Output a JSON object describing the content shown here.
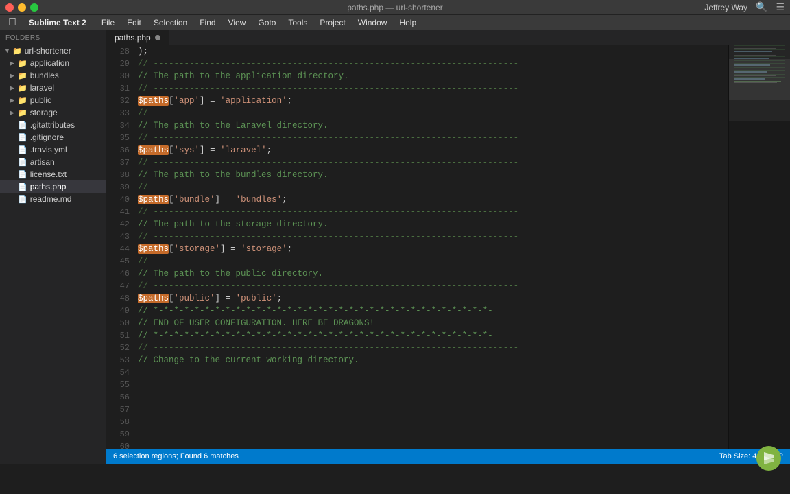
{
  "titlebar": {
    "app_name": "Sublime Text 2",
    "file_title": "paths.php — url-shortener",
    "user": "Jeffrey Way"
  },
  "menubar": {
    "items": [
      "File",
      "Edit",
      "Selection",
      "Find",
      "View",
      "Goto",
      "Tools",
      "Project",
      "Window",
      "Help"
    ]
  },
  "sidebar": {
    "header": "FOLDERS",
    "root": "url-shortener",
    "items": [
      {
        "label": "application",
        "type": "folder",
        "indent": 1,
        "expanded": false
      },
      {
        "label": "bundles",
        "type": "folder",
        "indent": 1,
        "expanded": false
      },
      {
        "label": "laravel",
        "type": "folder",
        "indent": 1,
        "expanded": false
      },
      {
        "label": "public",
        "type": "folder",
        "indent": 1,
        "expanded": false
      },
      {
        "label": "storage",
        "type": "folder",
        "indent": 1,
        "expanded": false
      },
      {
        "label": ".gitattributes",
        "type": "file",
        "indent": 1
      },
      {
        "label": ".gitignore",
        "type": "file",
        "indent": 1
      },
      {
        "label": ".travis.yml",
        "type": "file",
        "indent": 1
      },
      {
        "label": "artisan",
        "type": "file",
        "indent": 1
      },
      {
        "label": "license.txt",
        "type": "file",
        "indent": 1
      },
      {
        "label": "paths.php",
        "type": "file",
        "indent": 1,
        "active": true
      },
      {
        "label": "readme.md",
        "type": "file",
        "indent": 1
      }
    ]
  },
  "tab": {
    "filename": "paths.php",
    "modified": true
  },
  "code": {
    "lines": [
      {
        "num": 28,
        "content": ");"
      },
      {
        "num": 29,
        "content": ""
      },
      {
        "num": 30,
        "content": "// -----------------------------------------------------------------------"
      },
      {
        "num": 31,
        "content": "// The path to the application directory."
      },
      {
        "num": 32,
        "content": "// -----------------------------------------------------------------------"
      },
      {
        "num": 33,
        "content": "$paths['app'] = 'application';",
        "highlight_var": true
      },
      {
        "num": 34,
        "content": ""
      },
      {
        "num": 35,
        "content": "// -----------------------------------------------------------------------"
      },
      {
        "num": 36,
        "content": "// The path to the Laravel directory."
      },
      {
        "num": 37,
        "content": "// -----------------------------------------------------------------------"
      },
      {
        "num": 38,
        "content": "$paths['sys'] = 'laravel';",
        "highlight_var": true
      },
      {
        "num": 39,
        "content": ""
      },
      {
        "num": 40,
        "content": "// -----------------------------------------------------------------------"
      },
      {
        "num": 41,
        "content": "// The path to the bundles directory."
      },
      {
        "num": 42,
        "content": "// -----------------------------------------------------------------------"
      },
      {
        "num": 43,
        "content": "$paths['bundle'] = 'bundles';",
        "highlight_var": true
      },
      {
        "num": 44,
        "content": ""
      },
      {
        "num": 45,
        "content": "// -----------------------------------------------------------------------"
      },
      {
        "num": 46,
        "content": "// The path to the storage directory."
      },
      {
        "num": 47,
        "content": "// -----------------------------------------------------------------------"
      },
      {
        "num": 48,
        "content": "$paths['storage'] = 'storage';",
        "highlight_var": true
      },
      {
        "num": 49,
        "content": ""
      },
      {
        "num": 50,
        "content": "// -----------------------------------------------------------------------"
      },
      {
        "num": 51,
        "content": "// The path to the public directory."
      },
      {
        "num": 52,
        "content": "// -----------------------------------------------------------------------"
      },
      {
        "num": 53,
        "content": "$paths['public'] = 'public';",
        "highlight_var": true
      },
      {
        "num": 54,
        "content": ""
      },
      {
        "num": 55,
        "content": "// *-*-*-*-*-*-*-*-*-*-*-*-*-*-*-*-*-*-*-*-*-*-*-*-*-*-*-*-*-*-*-*-*-"
      },
      {
        "num": 56,
        "content": "// END OF USER CONFIGURATION. HERE BE DRAGONS!"
      },
      {
        "num": 57,
        "content": "// *-*-*-*-*-*-*-*-*-*-*-*-*-*-*-*-*-*-*-*-*-*-*-*-*-*-*-*-*-*-*-*-*-"
      },
      {
        "num": 58,
        "content": ""
      },
      {
        "num": 59,
        "content": "// -----------------------------------------------------------------------"
      },
      {
        "num": 60,
        "content": "// Change to the current working directory."
      }
    ]
  },
  "statusbar": {
    "left": "6 selection regions; Found 6 matches",
    "tab_size": "Tab Size: 4",
    "language": "PHP"
  }
}
